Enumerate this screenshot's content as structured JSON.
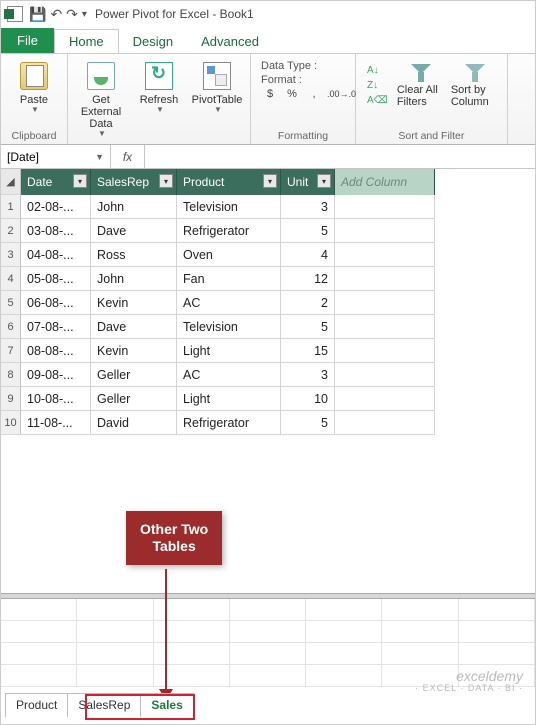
{
  "titlebar": {
    "title": "Power Pivot for Excel - Book1"
  },
  "ribbon_tabs": {
    "file": "File",
    "home": "Home",
    "design": "Design",
    "advanced": "Advanced"
  },
  "ribbon": {
    "clipboard": {
      "paste": "Paste",
      "group": "Clipboard"
    },
    "getdata": "Get External Data",
    "refresh": "Refresh",
    "pivot": "PivotTable",
    "fmt": {
      "datatype": "Data Type :",
      "format": "Format :",
      "group": "Formatting"
    },
    "sort": {
      "az": "A↓",
      "za": "Z↓",
      "clear": "Clear All Filters",
      "sortby": "Sort by Column",
      "group": "Sort and Filter"
    }
  },
  "namebox": "[Date]",
  "columns": {
    "date": "Date",
    "rep": "SalesRep",
    "prod": "Product",
    "unit": "Unit",
    "add": "Add Column"
  },
  "rows": [
    {
      "n": "1",
      "date": "02-08-...",
      "rep": "John",
      "prod": "Television",
      "unit": "3"
    },
    {
      "n": "2",
      "date": "03-08-...",
      "rep": "Dave",
      "prod": "Refrigerator",
      "unit": "5"
    },
    {
      "n": "3",
      "date": "04-08-...",
      "rep": "Ross",
      "prod": "Oven",
      "unit": "4"
    },
    {
      "n": "4",
      "date": "05-08-...",
      "rep": "John",
      "prod": "Fan",
      "unit": "12"
    },
    {
      "n": "5",
      "date": "06-08-...",
      "rep": "Kevin",
      "prod": "AC",
      "unit": "2"
    },
    {
      "n": "6",
      "date": "07-08-...",
      "rep": "Dave",
      "prod": "Television",
      "unit": "5"
    },
    {
      "n": "7",
      "date": "08-08-...",
      "rep": "Kevin",
      "prod": "Light",
      "unit": "15"
    },
    {
      "n": "8",
      "date": "09-08-...",
      "rep": "Geller",
      "prod": "AC",
      "unit": "3"
    },
    {
      "n": "9",
      "date": "10-08-...",
      "rep": "Geller",
      "prod": "Light",
      "unit": "10"
    },
    {
      "n": "10",
      "date": "11-08-...",
      "rep": "David",
      "prod": "Refrigerator",
      "unit": "5"
    }
  ],
  "callout": {
    "l1": "Other Two",
    "l2": "Tables"
  },
  "sheets": {
    "product": "Product",
    "salesrep": "SalesRep",
    "sales": "Sales"
  },
  "watermark": {
    "main": "exceldemy",
    "sub": "· EXCEL · DATA · BI ·"
  }
}
